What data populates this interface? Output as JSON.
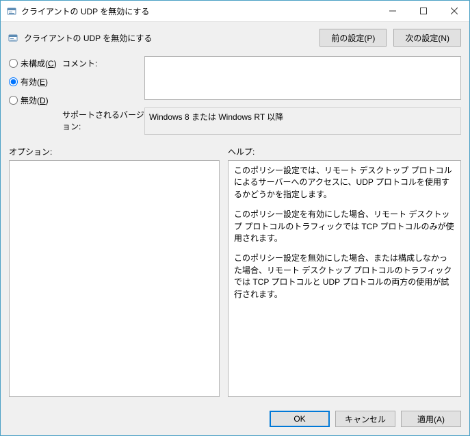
{
  "window": {
    "title": "クライアントの UDP を無効にする"
  },
  "header": {
    "heading": "クライアントの UDP を無効にする",
    "prev_label": "前の設定(P)",
    "next_label": "次の設定(N)"
  },
  "config": {
    "not_configured_label": "未構成(C)",
    "enabled_label": "有効(E)",
    "disabled_label": "無効(D)",
    "selected": "enabled",
    "comment_label": "コメント:",
    "comment_value": "",
    "supported_label": "サポートされるバージョン:",
    "supported_value": "Windows 8 または Windows RT 以降"
  },
  "labels": {
    "options": "オプション:",
    "help": "ヘルプ:"
  },
  "options_content": "",
  "help_paragraphs": {
    "p1": "このポリシー設定では、リモート デスクトップ プロトコルによるサーバーへのアクセスに、UDP プロトコルを使用するかどうかを指定します。",
    "p2": "このポリシー設定を有効にした場合、リモート デスクトップ プロトコルのトラフィックでは TCP プロトコルのみが使用されます。",
    "p3": "このポリシー設定を無効にした場合、または構成しなかった場合、リモート デスクトップ プロトコルのトラフィックでは TCP プロトコルと UDP プロトコルの両方の使用が試行されます。"
  },
  "footer": {
    "ok": "OK",
    "cancel": "キャンセル",
    "apply": "適用(A)"
  }
}
